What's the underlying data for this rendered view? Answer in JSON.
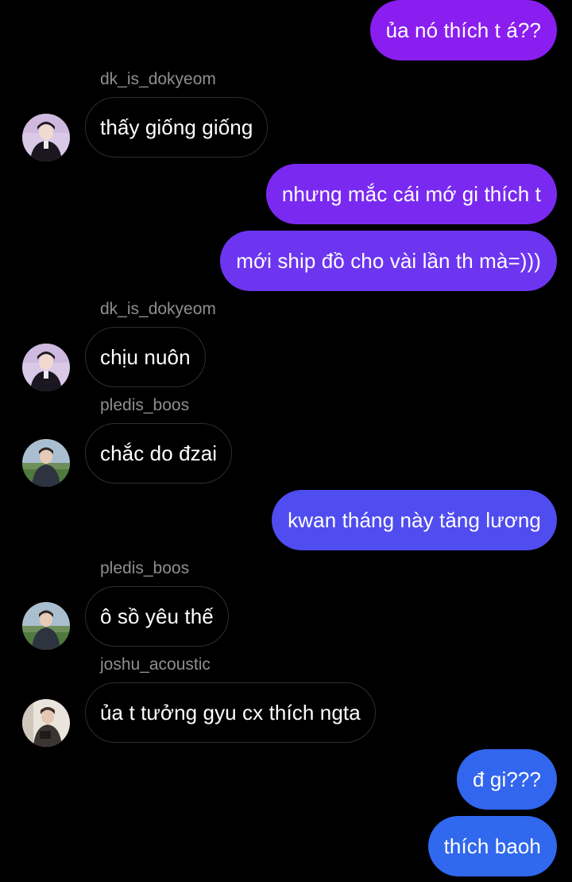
{
  "colors": {
    "background": "#000000",
    "incoming_border": "#2e2e2e",
    "sender_name": "#8e8e8e",
    "outgoing_purple": "#8a1ef0",
    "outgoing_violet": "#6d35f0",
    "outgoing_indigo": "#4f4cf0",
    "outgoing_blue": "#3068ee"
  },
  "messages": [
    {
      "dir": "out",
      "text": "ủa nó thích t á??"
    },
    {
      "dir": "in",
      "sender": "dk_is_dokyeom",
      "avatar": "avatar-dokyeom",
      "text": "thấy giống giống"
    },
    {
      "dir": "out",
      "text": "nhưng mắc cái mớ gi thích t"
    },
    {
      "dir": "out",
      "text": "mới ship đồ cho vài lần th mà=)))"
    },
    {
      "dir": "in",
      "sender": "dk_is_dokyeom",
      "avatar": "avatar-dokyeom",
      "text": "chịu nuôn"
    },
    {
      "dir": "in",
      "sender": "pledis_boos",
      "avatar": "avatar-boos",
      "text": "chắc do đzai"
    },
    {
      "dir": "out",
      "text": "kwan tháng này tăng lương"
    },
    {
      "dir": "in",
      "sender": "pledis_boos",
      "avatar": "avatar-boos",
      "text": "ô sồ yêu thế"
    },
    {
      "dir": "in",
      "sender": "joshu_acoustic",
      "avatar": "avatar-joshua",
      "text": "ủa t tưởng gyu cx thích ngta"
    },
    {
      "dir": "out",
      "text": "đ gi???"
    },
    {
      "dir": "out",
      "text": "thích baoh"
    }
  ]
}
